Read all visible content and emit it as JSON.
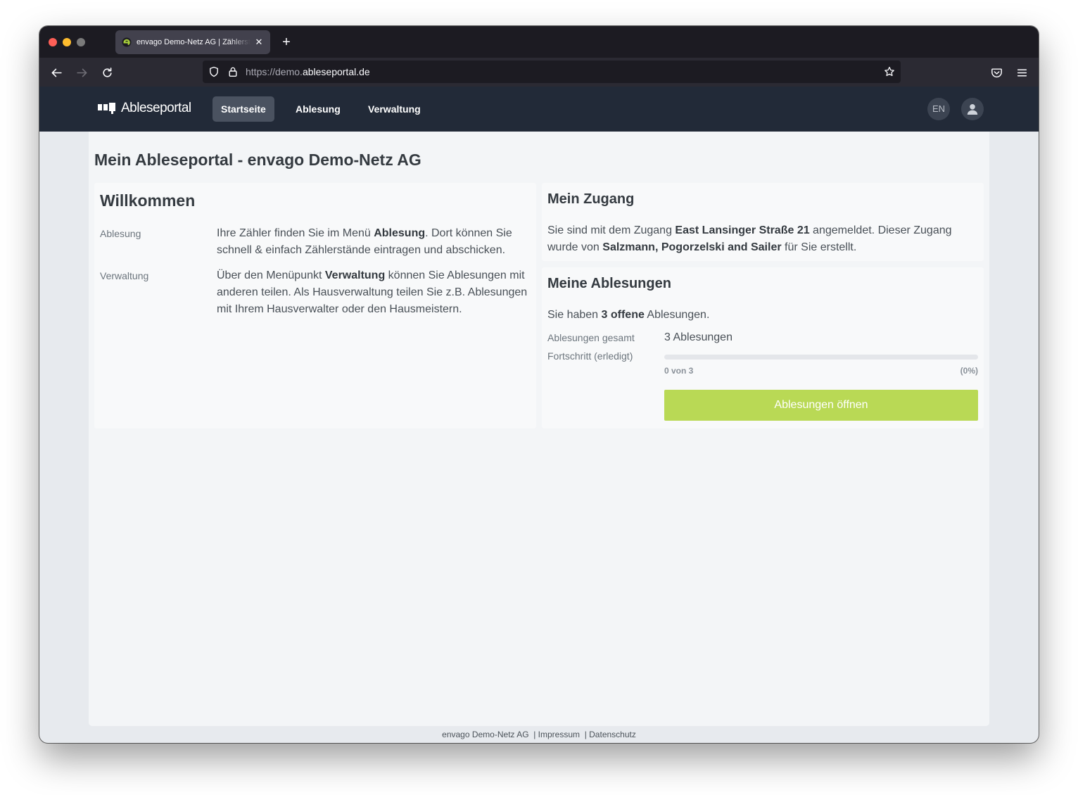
{
  "browser": {
    "tab_title": "envago Demo-Netz AG | Zählerstände",
    "url_dim_prefix": "https://demo.",
    "url_domain": "ableseportal.de"
  },
  "app": {
    "logo_text": "Ableseportal",
    "nav": [
      {
        "label": "Startseite",
        "active": true
      },
      {
        "label": "Ablesung",
        "active": false
      },
      {
        "label": "Verwaltung",
        "active": false
      }
    ],
    "lang_label": "EN"
  },
  "page": {
    "title": "Mein Ableseportal - envago Demo-Netz AG"
  },
  "welcome": {
    "heading": "Willkommen",
    "rows": [
      {
        "label": "Ablesung",
        "text_pre": "Ihre Zähler finden Sie im Menü ",
        "text_bold": "Ablesung",
        "text_post": ". Dort können Sie schnell & einfach Zählerstände eintragen und abschicken."
      },
      {
        "label": "Verwaltung",
        "text_pre": "Über den Menüpunkt ",
        "text_bold": "Verwaltung",
        "text_post": " können Sie Ablesungen mit anderen teilen. Als Hausverwaltung teilen Sie z.B. Ablesungen mit Ihrem Hausverwalter oder den Hausmeistern."
      }
    ]
  },
  "access": {
    "heading": "Mein Zugang",
    "text_1": "Sie sind mit dem Zugang ",
    "access_name": "East Lansinger Straße 21",
    "text_2": " angemeldet. Dieser Zugang wurde von ",
    "creator": "Salzmann, Pogorzelski and Sailer",
    "text_3": " für Sie erstellt."
  },
  "readings": {
    "heading": "Meine Ablesungen",
    "summary_pre": "Sie haben ",
    "summary_bold": "3 offene",
    "summary_post": " Ablesungen.",
    "total_label": "Ablesungen gesamt",
    "total_value": "3 Ablesungen",
    "progress_label": "Fortschritt (erledigt)",
    "progress_fraction": 0,
    "progress_count": "0 von 3",
    "progress_percent": "(0%)",
    "open_button": "Ablesungen öffnen"
  },
  "footer": {
    "company": "envago Demo-Netz AG",
    "impressum": "| Impressum",
    "datenschutz": "| Datenschutz"
  },
  "colors": {
    "nav_bg": "#222a38",
    "accent_green": "#b9d955"
  }
}
